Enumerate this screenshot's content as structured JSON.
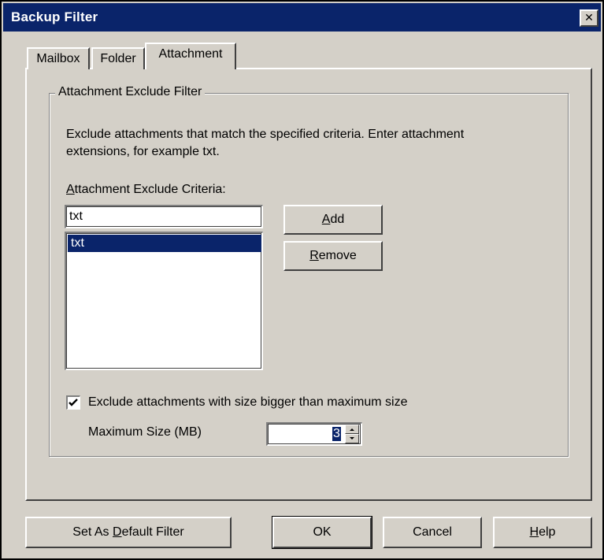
{
  "window": {
    "title": "Backup Filter",
    "close_glyph": "✕"
  },
  "tabs": [
    {
      "label": "Mailbox"
    },
    {
      "label": "Folder"
    },
    {
      "label": "Attachment",
      "selected": true
    }
  ],
  "group": {
    "legend": "Attachment Exclude Filter",
    "description_line1": "Exclude attachments that match the specified criteria. Enter attachment",
    "description_line2": "extensions, for example txt.",
    "criteria_label_accesskey": "A",
    "criteria_label_rest": "ttachment Exclude Criteria:",
    "criteria_input_value": "txt",
    "criteria_list": [
      "txt"
    ],
    "add_accesskey": "A",
    "add_rest": "dd",
    "remove_accesskey": "R",
    "remove_rest": "emove",
    "exclude_size_checked": true,
    "exclude_size_label": "Exclude attachments with size bigger than maximum size",
    "max_size_label": "Maximum Size (MB)",
    "max_size_value": "3"
  },
  "footer": {
    "set_default_prefix": "Set As ",
    "set_default_accesskey": "D",
    "set_default_rest": "efault Filter",
    "ok_label": "OK",
    "cancel_label": "Cancel",
    "help_accesskey": "H",
    "help_rest": "elp"
  },
  "colors": {
    "face": "#d4d0c8",
    "titlebar": "#0a246a",
    "selection": "#0a246a"
  }
}
